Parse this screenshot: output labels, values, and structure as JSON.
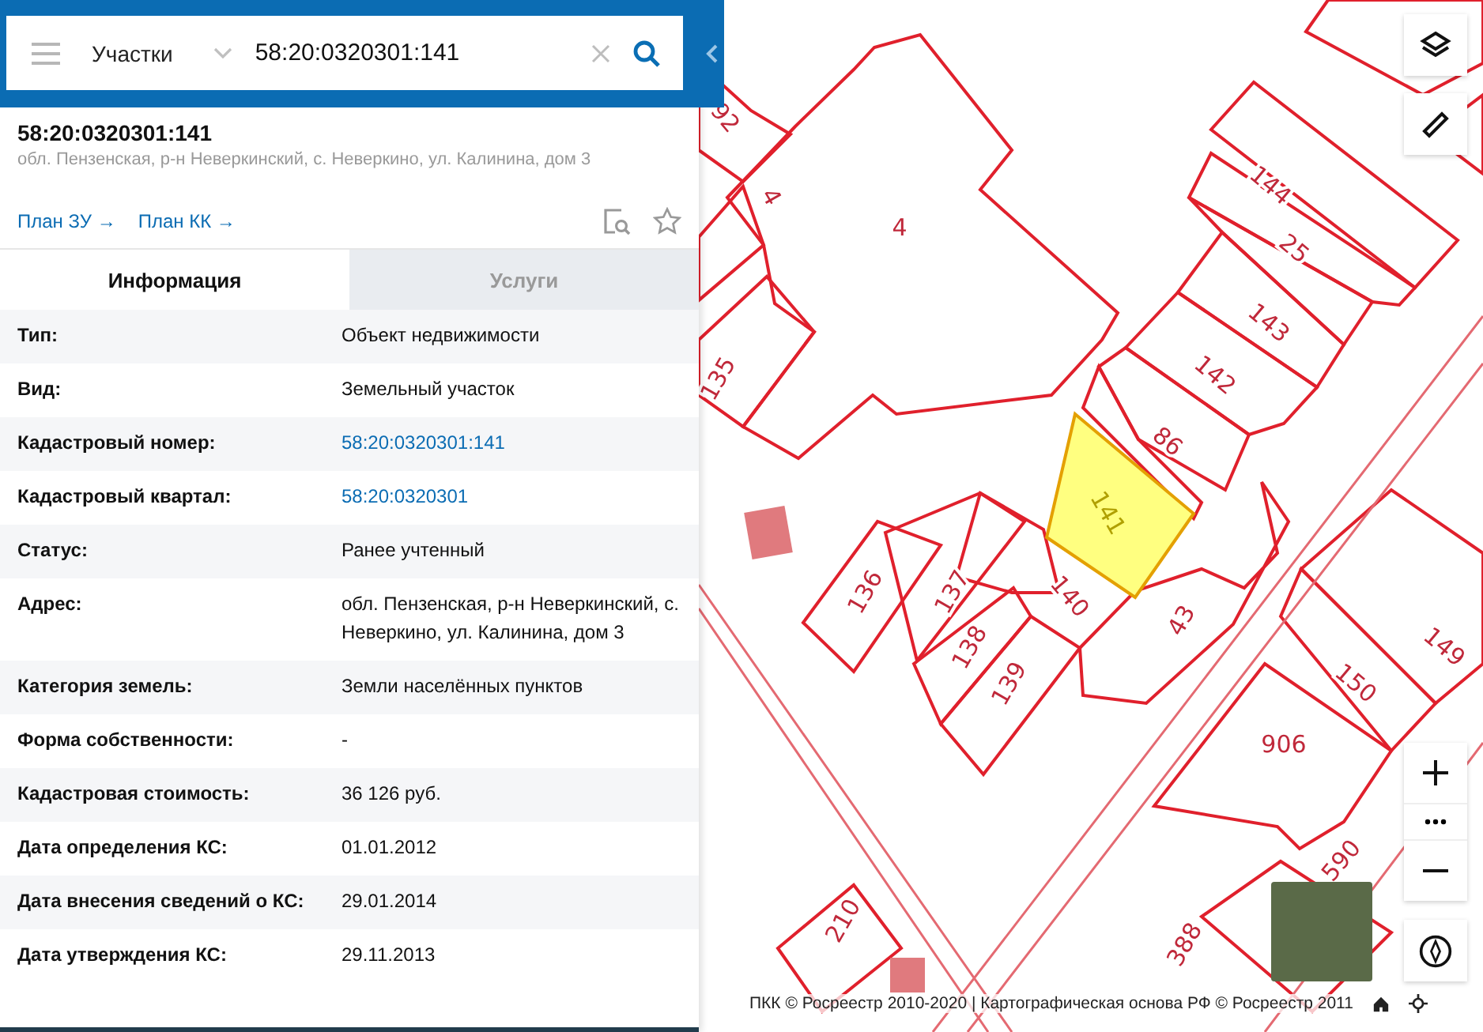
{
  "search": {
    "category": "Участки",
    "value": "58:20:0320301:141"
  },
  "object": {
    "title": "58:20:0320301:141",
    "address": "обл. Пензенская, р-н Неверкинский, с. Неверкино, ул. Калинина, дом 3",
    "links": [
      "План ЗУ →",
      "План КК →"
    ]
  },
  "tabs": [
    {
      "label": "Информация",
      "selected": true
    },
    {
      "label": "Услуги",
      "selected": false
    }
  ],
  "rows": [
    {
      "label": "Тип:",
      "value": "Объект недвижимости",
      "kind": "text"
    },
    {
      "label": "Вид:",
      "value": "Земельный участок",
      "kind": "text"
    },
    {
      "label": "Кадастровый номер:",
      "value": "58:20:0320301:141",
      "kind": "link"
    },
    {
      "label": "Кадастровый квартал:",
      "value": "58:20:0320301",
      "kind": "link"
    },
    {
      "label": "Статус:",
      "value": "Ранее учтенный",
      "kind": "text"
    },
    {
      "label": "Адрес:",
      "value": "обл. Пензенская, р-н Неверкинский, с. Неверкино, ул. Калинина, дом 3",
      "kind": "text"
    },
    {
      "label": "Категория земель:",
      "value": "Земли населённых пунктов",
      "kind": "text"
    },
    {
      "label": "Форма собственности:",
      "value": "-",
      "kind": "text"
    },
    {
      "label": "Кадастровая стоимость:",
      "value": "36 126 руб.",
      "kind": "text"
    },
    {
      "label": "Дата определения КС:",
      "value": "01.01.2012",
      "kind": "text"
    },
    {
      "label": "Дата внесения сведений о КС:",
      "value": "29.01.2014",
      "kind": "text"
    },
    {
      "label": "Дата утверждения КС:",
      "value": "29.11.2013",
      "kind": "text"
    }
  ],
  "map": {
    "labels": [
      {
        "text": "92",
        "selected": false
      },
      {
        "text": "4",
        "selected": false
      },
      {
        "text": "4",
        "selected": false
      },
      {
        "text": "144",
        "selected": false
      },
      {
        "text": "25",
        "selected": false
      },
      {
        "text": "143",
        "selected": false
      },
      {
        "text": "142",
        "selected": false
      },
      {
        "text": "86",
        "selected": false
      },
      {
        "text": "135",
        "selected": false
      },
      {
        "text": "141",
        "selected": true
      },
      {
        "text": "136",
        "selected": false
      },
      {
        "text": "137",
        "selected": false
      },
      {
        "text": "140",
        "selected": false
      },
      {
        "text": "138",
        "selected": false
      },
      {
        "text": "139",
        "selected": false
      },
      {
        "text": "43",
        "selected": false
      },
      {
        "text": "149",
        "selected": false
      },
      {
        "text": "150",
        "selected": false
      },
      {
        "text": "906",
        "selected": false
      },
      {
        "text": "590",
        "selected": false
      },
      {
        "text": "388",
        "selected": false
      },
      {
        "text": "210",
        "selected": false
      }
    ],
    "attribution": "ПКК © Росреестр 2010-2020 | Картографическая основа РФ © Росреестр 2011"
  }
}
